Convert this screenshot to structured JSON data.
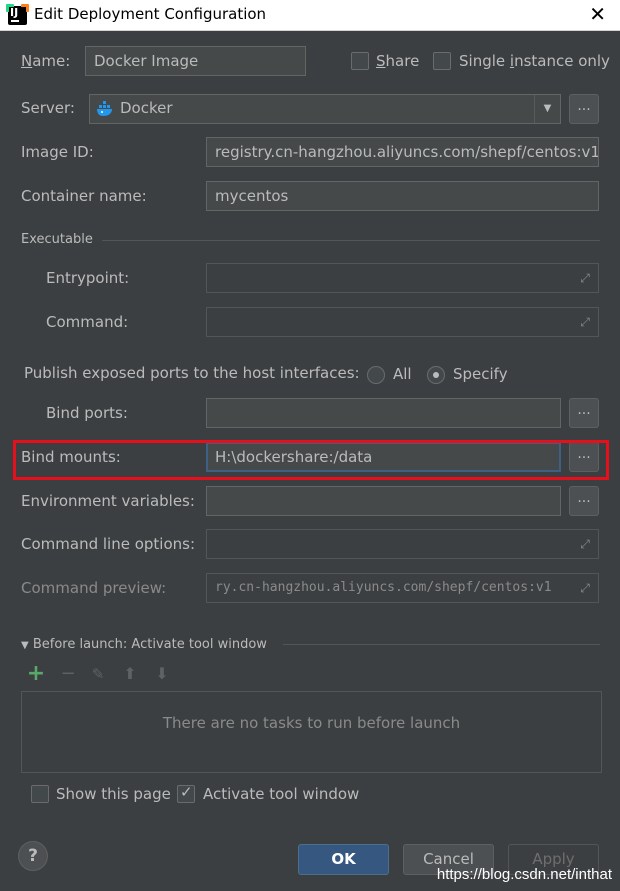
{
  "window": {
    "title": "Edit Deployment Configuration",
    "close": "✕"
  },
  "name": {
    "label": "Name:",
    "value": "Docker Image"
  },
  "share": {
    "label": "Share",
    "checked": false
  },
  "single_instance": {
    "label": "Single instance only",
    "checked": false
  },
  "server": {
    "label": "Server:",
    "value": "Docker",
    "button": "..."
  },
  "image_id": {
    "label": "Image ID:",
    "value": "registry.cn-hangzhou.aliyuncs.com/shepf/centos:v1"
  },
  "container_name": {
    "label": "Container name:",
    "value": "mycentos"
  },
  "executable": {
    "section": "Executable",
    "entrypoint": {
      "label": "Entrypoint:",
      "value": ""
    },
    "command": {
      "label": "Command:",
      "value": ""
    }
  },
  "publish_ports": {
    "label": "Publish exposed ports to the host interfaces:",
    "options": [
      "All",
      "Specify"
    ],
    "selected": "Specify"
  },
  "bind_ports": {
    "label": "Bind ports:",
    "value": "",
    "button": "..."
  },
  "bind_mounts": {
    "label": "Bind mounts:",
    "value": "H:\\dockershare:/data",
    "button": "..."
  },
  "env_vars": {
    "label": "Environment variables:",
    "value": "",
    "button": "..."
  },
  "cmd_options": {
    "label": "Command line options:",
    "value": ""
  },
  "cmd_preview": {
    "label": "Command preview:",
    "value": "ry.cn-hangzhou.aliyuncs.com/shepf/centos:v1"
  },
  "before_launch": {
    "header": "Before launch: Activate tool window",
    "empty_text": "There are no tasks to run before launch"
  },
  "show_page": {
    "label": "Show this page",
    "checked": false
  },
  "activate_tool": {
    "label": "Activate tool window",
    "checked": true
  },
  "buttons": {
    "ok": "OK",
    "cancel": "Cancel",
    "apply": "Apply",
    "help": "?"
  },
  "watermark": "https://blog.csdn.net/inthat",
  "colors": {
    "accent": "#365880",
    "highlight": "#e60f1c",
    "add_icon": "#59a869"
  }
}
